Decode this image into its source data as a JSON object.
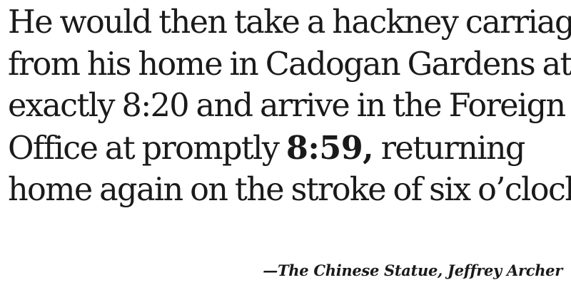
{
  "quote": {
    "line1": "He would then take a hackney carriage",
    "line2": "from his home in Cadogan Gardens at",
    "line3": "exactly 8:20 and arrive in the Foreign",
    "line4_before": "Office at promptly ",
    "line4_time": "8:59,",
    "line4_after": " returning",
    "line5": "home again on the stroke of six o’clock."
  },
  "attribution": {
    "text": "—The Chinese Statue, Jeffrey Archer"
  }
}
